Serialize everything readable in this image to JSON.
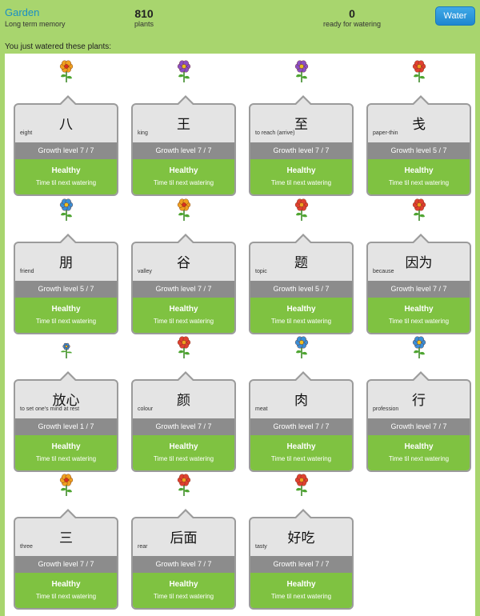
{
  "header": {
    "title": "Garden",
    "subtitle": "Long term memory",
    "plants_count": "810",
    "plants_label": "plants",
    "ready_count": "0",
    "ready_label": "ready for watering",
    "water_label": "Water"
  },
  "intro": "You just watered these plants:",
  "colors": {
    "background": "#a8d56e",
    "brand": "#1a8fc4",
    "healthy": "#7fc241",
    "growth_bar": "#8c8c8c",
    "button": "#2596dc"
  },
  "cards": [
    {
      "hanzi": "八",
      "meaning": "eight",
      "growth": "Growth level 7 / 7",
      "status": "Healthy",
      "next": "Time til next watering",
      "flower": "orange"
    },
    {
      "hanzi": "王",
      "meaning": "king",
      "growth": "Growth level 7 / 7",
      "status": "Healthy",
      "next": "Time til next watering",
      "flower": "purple"
    },
    {
      "hanzi": "至",
      "meaning": "to reach (arrive)",
      "growth": "Growth level 7 / 7",
      "status": "Healthy",
      "next": "Time til next watering",
      "flower": "purple"
    },
    {
      "hanzi": "戋",
      "meaning": "paper-thin",
      "growth": "Growth level 5 / 7",
      "status": "Healthy",
      "next": "Time til next watering",
      "flower": "red"
    },
    {
      "hanzi": "朋",
      "meaning": "friend",
      "growth": "Growth level 5 / 7",
      "status": "Healthy",
      "next": "Time til next watering",
      "flower": "blue"
    },
    {
      "hanzi": "谷",
      "meaning": "valley",
      "growth": "Growth level 7 / 7",
      "status": "Healthy",
      "next": "Time til next watering",
      "flower": "orange"
    },
    {
      "hanzi": "题",
      "meaning": "topic",
      "growth": "Growth level 5 / 7",
      "status": "Healthy",
      "next": "Time til next watering",
      "flower": "red"
    },
    {
      "hanzi": "因为",
      "meaning": "because",
      "growth": "Growth level 7 / 7",
      "status": "Healthy",
      "next": "Time til next watering",
      "flower": "red"
    },
    {
      "hanzi": "放心",
      "meaning": "to set one's mind at rest",
      "growth": "Growth level 1 / 7",
      "status": "Healthy",
      "next": "Time til next watering",
      "flower": "blue-small"
    },
    {
      "hanzi": "颜",
      "meaning": "colour",
      "growth": "Growth level 7 / 7",
      "status": "Healthy",
      "next": "Time til next watering",
      "flower": "red"
    },
    {
      "hanzi": "肉",
      "meaning": "meat",
      "growth": "Growth level 7 / 7",
      "status": "Healthy",
      "next": "Time til next watering",
      "flower": "blue"
    },
    {
      "hanzi": "行",
      "meaning": "profession",
      "growth": "Growth level 7 / 7",
      "status": "Healthy",
      "next": "Time til next watering",
      "flower": "blue"
    },
    {
      "hanzi": "三",
      "meaning": "three",
      "growth": "Growth level 7 / 7",
      "status": "Healthy",
      "next": "Time til next watering",
      "flower": "orange"
    },
    {
      "hanzi": "后面",
      "meaning": "rear",
      "growth": "Growth level 7 / 7",
      "status": "Healthy",
      "next": "Time til next watering",
      "flower": "red"
    },
    {
      "hanzi": "好吃",
      "meaning": "tasty",
      "growth": "Growth level 7 / 7",
      "status": "Healthy",
      "next": "Time til next watering",
      "flower": "red"
    }
  ]
}
